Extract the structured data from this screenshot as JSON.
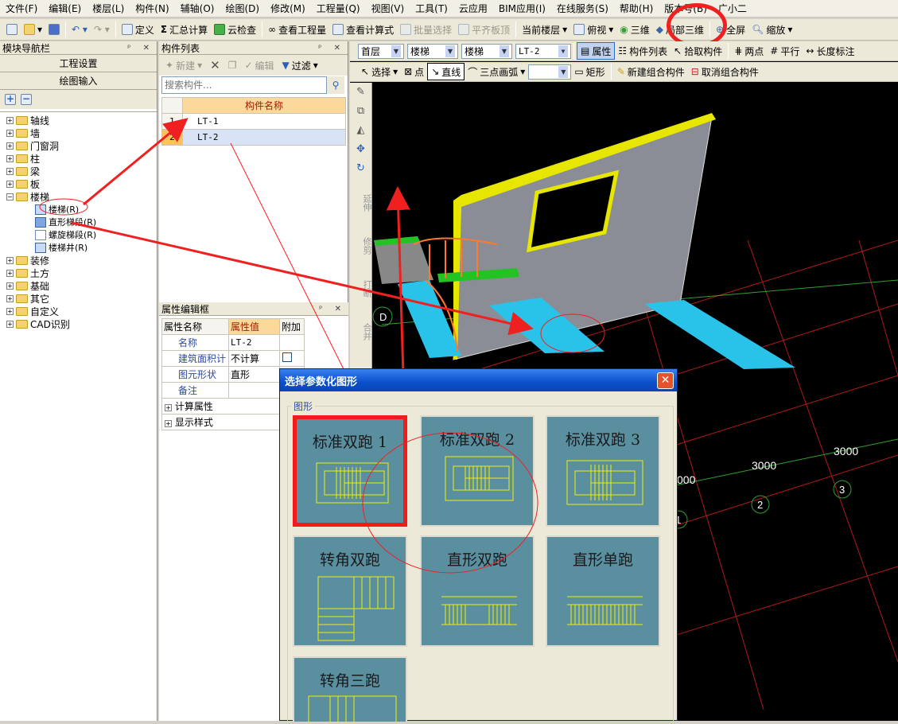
{
  "menu": [
    "文件(F)",
    "编辑(E)",
    "楼层(L)",
    "构件(N)",
    "辅轴(O)",
    "绘图(D)",
    "修改(M)",
    "工程量(Q)",
    "视图(V)",
    "工具(T)",
    "云应用",
    "BIM应用(I)",
    "在线服务(S)",
    "帮助(H)",
    "版本号(B)",
    "广小二"
  ],
  "toolbar1": {
    "define": "定义",
    "sum": "汇总计算",
    "cloud_check": "云检查",
    "view_qty": "查看工程量",
    "view_formula": "查看计算式",
    "batch_select": "批量选择",
    "flush_top": "平齐板顶",
    "current_floor": "当前楼层",
    "top_view": "俯视",
    "three_d": "三维",
    "local_3d": "局部三维",
    "fullscreen": "全屏",
    "zoom": "缩放"
  },
  "nav": {
    "title": "模块导航栏",
    "btn_project": "工程设置",
    "btn_draw": "绘图输入",
    "tree": [
      {
        "label": "轴线",
        "level": 0
      },
      {
        "label": "墙",
        "level": 0
      },
      {
        "label": "门窗洞",
        "level": 0
      },
      {
        "label": "柱",
        "level": 0
      },
      {
        "label": "梁",
        "level": 0
      },
      {
        "label": "板",
        "level": 0
      },
      {
        "label": "楼梯",
        "level": 0,
        "open": true
      },
      {
        "label": "楼梯(R)",
        "level": 1
      },
      {
        "label": "直形梯段(R)",
        "level": 1
      },
      {
        "label": "螺旋梯段(R)",
        "level": 1
      },
      {
        "label": "楼梯井(R)",
        "level": 1
      },
      {
        "label": "装修",
        "level": 0
      },
      {
        "label": "土方",
        "level": 0
      },
      {
        "label": "基础",
        "level": 0
      },
      {
        "label": "其它",
        "level": 0
      },
      {
        "label": "自定义",
        "level": 0
      },
      {
        "label": "CAD识别",
        "level": 0
      }
    ]
  },
  "plist": {
    "title": "构件列表",
    "new": "新建",
    "edit": "编辑",
    "filter": "过滤",
    "search_placeholder": "搜索构件...",
    "col": "构件名称",
    "rows": [
      {
        "n": "1",
        "name": "LT-1"
      },
      {
        "n": "2",
        "name": "LT-2"
      }
    ]
  },
  "pedit": {
    "title": "属性编辑框",
    "h_name": "属性名称",
    "h_val": "属性值",
    "h_add": "附加",
    "rows": [
      {
        "k": "名称",
        "v": "LT-2"
      },
      {
        "k": "建筑面积计",
        "v": "不计算"
      },
      {
        "k": "图元形状",
        "v": "直形"
      },
      {
        "k": "备注",
        "v": ""
      }
    ],
    "groups": [
      "计算属性",
      "显示样式"
    ]
  },
  "cad": {
    "floor": "首层",
    "cat1": "楼梯",
    "cat2": "楼梯",
    "item": "LT-2",
    "prop": "属性",
    "clist": "构件列表",
    "pick": "拾取构件",
    "two_pt": "两点",
    "parallel": "平行",
    "len_mark": "长度标注",
    "select": "选择",
    "point": "点",
    "line": "直线",
    "arc3": "三点画弧",
    "rect": "矩形",
    "new_combo": "新建组合构件",
    "cancel_combo": "取消组合构件",
    "side_tools": [
      "延伸",
      "修剪",
      "打断",
      "合并"
    ],
    "axis_d": "D",
    "dims": [
      "3000",
      "3000",
      "000"
    ],
    "axis_nums": [
      "1",
      "2",
      "3"
    ]
  },
  "dialog": {
    "title": "选择参数化图形",
    "group": "图形",
    "tiles": [
      "标准双跑 1",
      "标准双跑 2",
      "标准双跑 3",
      "转角双跑",
      "直形双跑",
      "直形单跑",
      "转角三跑"
    ]
  },
  "colors": {
    "annotation": "#f02020",
    "accent": "#0a4fc9"
  }
}
